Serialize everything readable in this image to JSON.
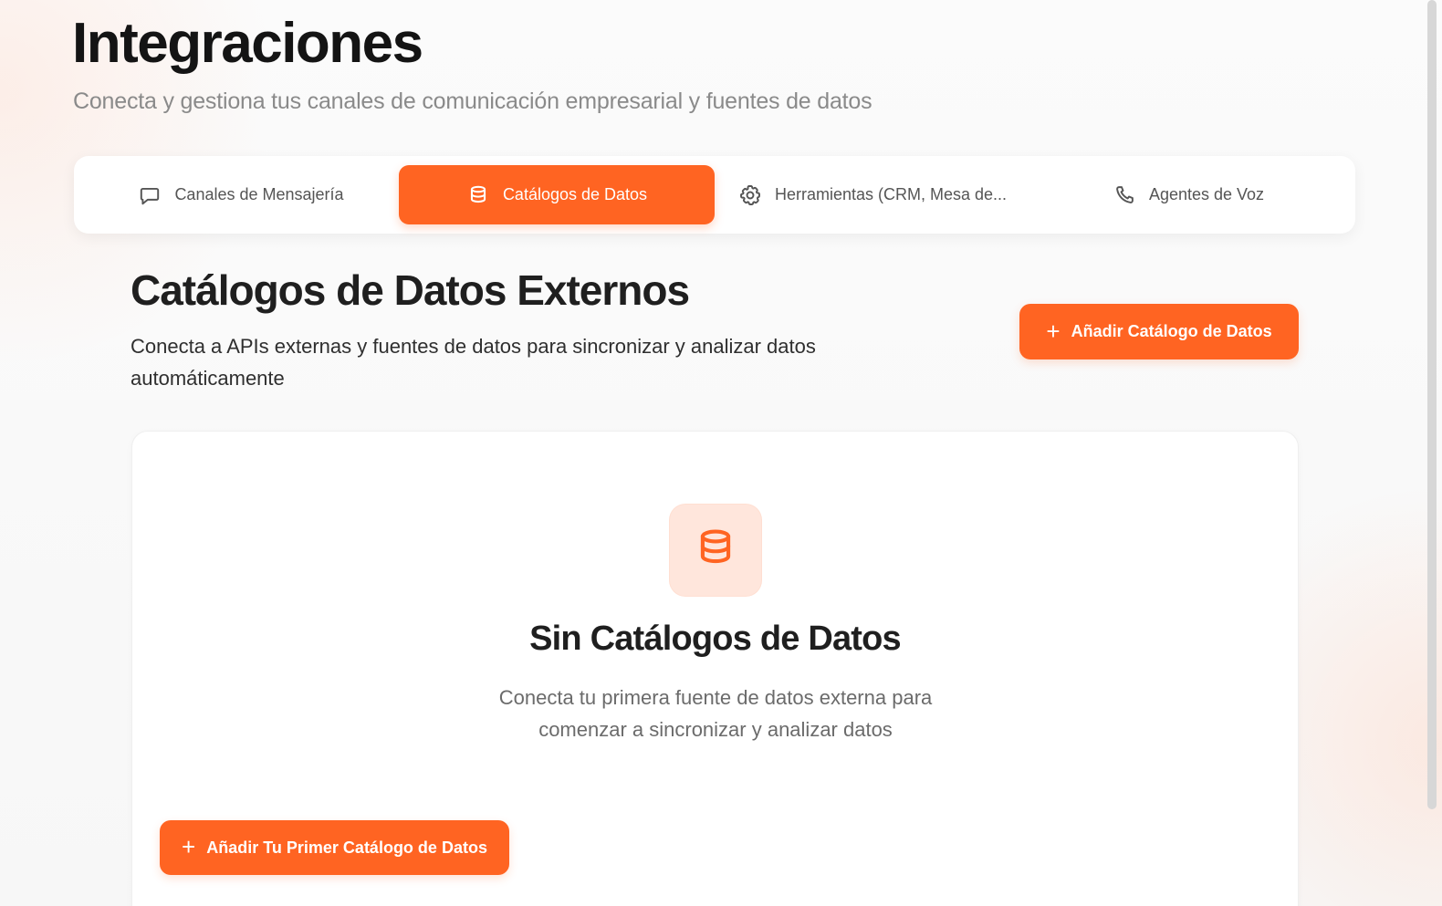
{
  "header": {
    "title": "Integraciones",
    "subtitle": "Conecta y gestiona tus canales de comunicación empresarial y fuentes de datos"
  },
  "tabs": [
    {
      "label": "Canales de Mensajería",
      "icon": "message-square-icon",
      "active": false
    },
    {
      "label": "Catálogos de Datos",
      "icon": "database-icon",
      "active": true
    },
    {
      "label": "Herramientas (CRM, Mesa de...",
      "icon": "gear-icon",
      "active": false
    },
    {
      "label": "Agentes de Voz",
      "icon": "phone-icon",
      "active": false
    }
  ],
  "section": {
    "title": "Catálogos de Datos Externos",
    "description": "Conecta a APIs externas y fuentes de datos para sincronizar y analizar datos automáticamente",
    "add_button_label": "Añadir Catálogo de Datos"
  },
  "empty_state": {
    "icon": "database-icon",
    "title": "Sin Catálogos de Datos",
    "description": "Conecta tu primera fuente de datos externa para comenzar a sincronizar y analizar datos",
    "button_label": "Añadir Tu Primer Catálogo de Datos"
  },
  "colors": {
    "accent": "#ff6422",
    "accent_soft": "#ffe6dc",
    "text_primary": "#1f1f1f",
    "text_secondary": "#8a8a8a"
  }
}
